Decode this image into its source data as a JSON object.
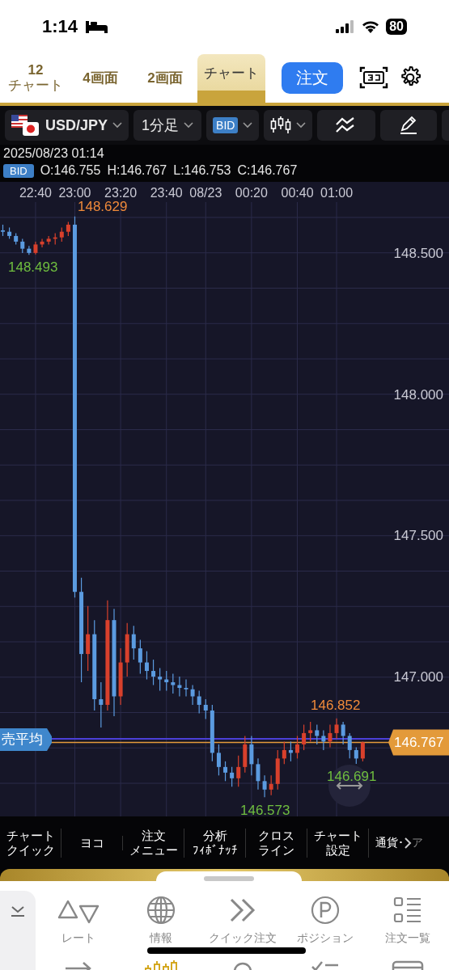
{
  "status_bar": {
    "time": "1:14",
    "battery": "80"
  },
  "tabs": [
    {
      "lines": [
        "12",
        "チャート"
      ],
      "selected": false
    },
    {
      "lines": [
        "4画面"
      ],
      "selected": false
    },
    {
      "lines": [
        "2画面"
      ],
      "selected": false
    },
    {
      "lines": [
        "チャート"
      ],
      "selected": true
    }
  ],
  "order_button": "注文",
  "toolbar": {
    "pair": "USD/JPY",
    "timeframe": "1分足",
    "price_type": "BID"
  },
  "info": {
    "datetime": "2025/08/23 01:14",
    "price_type": "BID",
    "ohlc": [
      "O:146.755",
      "H:146.767",
      "L:146.753",
      "C:146.767"
    ]
  },
  "chart": {
    "chart_data": {
      "type": "candlestick",
      "grid": true,
      "ylim": [
        146.505,
        148.68
      ],
      "categories": [
        null,
        null,
        null,
        null,
        null,
        "22:40",
        null,
        null,
        null,
        null,
        null,
        "23:00",
        null,
        null,
        null,
        null,
        null,
        null,
        "23:20",
        null,
        null,
        null,
        null,
        null,
        null,
        "23:40",
        null,
        null,
        null,
        null,
        null,
        "08/23",
        null,
        null,
        null,
        null,
        null,
        null,
        "00:20",
        null,
        null,
        null,
        null,
        null,
        null,
        "00:40",
        null,
        null,
        null,
        null,
        null,
        "01:00",
        null,
        null,
        null,
        null
      ],
      "ref_lines": [
        {
          "axis": "y",
          "label": "売平均",
          "value": 146.78,
          "color": "#4b3fd8"
        },
        {
          "axis": "y",
          "label": "146.767",
          "value": 146.767,
          "color": "#e39a3a"
        }
      ],
      "yticks": [
        {
          "value": 148.5,
          "label": "148.500"
        },
        {
          "value": 148.0,
          "label": "148.000"
        },
        {
          "value": 147.5,
          "label": "147.500"
        },
        {
          "value": 147.0,
          "label": "147.000"
        }
      ],
      "ohlc": [
        [
          148.58,
          148.6,
          148.56,
          148.575
        ],
        [
          148.575,
          148.59,
          148.55,
          148.56
        ],
        [
          148.56,
          148.57,
          148.53,
          148.54
        ],
        [
          148.54,
          148.55,
          148.5,
          148.515
        ],
        [
          148.515,
          148.525,
          148.493,
          148.5
        ],
        [
          148.5,
          148.54,
          148.495,
          148.53
        ],
        [
          148.53,
          148.55,
          148.52,
          148.54
        ],
        [
          148.54,
          148.56,
          148.53,
          148.55
        ],
        [
          148.55,
          148.57,
          148.53,
          148.555
        ],
        [
          148.555,
          148.59,
          148.54,
          148.575
        ],
        [
          148.575,
          148.61,
          148.56,
          148.6
        ],
        [
          148.6,
          148.629,
          147.28,
          147.3
        ],
        [
          147.3,
          147.35,
          146.98,
          147.08
        ],
        [
          147.08,
          147.25,
          147.02,
          147.15
        ],
        [
          147.15,
          147.2,
          146.88,
          146.92
        ],
        [
          146.92,
          146.98,
          146.82,
          146.9
        ],
        [
          146.9,
          147.27,
          146.88,
          147.2
        ],
        [
          147.2,
          147.24,
          146.86,
          146.93
        ],
        [
          146.93,
          147.1,
          146.9,
          147.05
        ],
        [
          147.05,
          147.19,
          147.0,
          147.15
        ],
        [
          147.15,
          147.18,
          147.06,
          147.1
        ],
        [
          147.1,
          147.13,
          147.01,
          147.05
        ],
        [
          147.05,
          147.09,
          146.99,
          147.02
        ],
        [
          147.02,
          147.06,
          146.97,
          147.0
        ],
        [
          147.0,
          147.03,
          146.95,
          146.99
        ],
        [
          146.99,
          147.02,
          146.95,
          146.98
        ],
        [
          146.98,
          147.01,
          146.94,
          146.97
        ],
        [
          146.97,
          147.0,
          146.93,
          146.96
        ],
        [
          146.96,
          146.99,
          146.93,
          146.955
        ],
        [
          146.955,
          146.97,
          146.9,
          146.93
        ],
        [
          146.93,
          146.95,
          146.87,
          146.9
        ],
        [
          146.9,
          146.92,
          146.85,
          146.88
        ],
        [
          146.88,
          146.9,
          146.7,
          146.73
        ],
        [
          146.73,
          146.76,
          146.65,
          146.68
        ],
        [
          146.68,
          146.7,
          146.63,
          146.66
        ],
        [
          146.66,
          146.68,
          146.61,
          146.64
        ],
        [
          146.64,
          146.72,
          146.61,
          146.68
        ],
        [
          146.68,
          146.79,
          146.66,
          146.76
        ],
        [
          146.76,
          146.79,
          146.65,
          146.69
        ],
        [
          146.69,
          146.71,
          146.6,
          146.63
        ],
        [
          146.63,
          146.65,
          146.573,
          146.6
        ],
        [
          146.6,
          146.65,
          146.58,
          146.62
        ],
        [
          146.62,
          146.74,
          146.6,
          146.71
        ],
        [
          146.71,
          146.77,
          146.69,
          146.74
        ],
        [
          146.74,
          146.77,
          146.7,
          146.73
        ],
        [
          146.73,
          146.79,
          146.71,
          146.76
        ],
        [
          146.76,
          146.83,
          146.74,
          146.8
        ],
        [
          146.8,
          146.84,
          146.77,
          146.81
        ],
        [
          146.81,
          146.83,
          146.76,
          146.79
        ],
        [
          146.79,
          146.81,
          146.74,
          146.77
        ],
        [
          146.77,
          146.83,
          146.75,
          146.8
        ],
        [
          146.8,
          146.852,
          146.78,
          146.83
        ],
        [
          146.83,
          146.84,
          146.76,
          146.79
        ],
        [
          146.79,
          146.8,
          146.71,
          146.74
        ],
        [
          146.74,
          146.75,
          146.691,
          146.71
        ],
        [
          146.71,
          146.77,
          146.7,
          146.767
        ]
      ]
    },
    "annotations": [
      {
        "kind": "high",
        "text": "148.629"
      },
      {
        "kind": "low",
        "text": "148.493"
      },
      {
        "kind": "high",
        "text": "146.852"
      },
      {
        "kind": "low",
        "text": "146.691"
      },
      {
        "kind": "low",
        "text": "146.573"
      }
    ]
  },
  "bottom_menu": [
    {
      "lines": [
        "チャート",
        "クイック"
      ]
    },
    {
      "lines": [
        "ヨコ"
      ]
    },
    {
      "lines": [
        "注文",
        "メニュー"
      ]
    },
    {
      "lines": [
        "分析",
        "ﾌｨﾎﾞﾅｯﾁ"
      ]
    },
    {
      "lines": [
        "クロス",
        "ライン"
      ]
    },
    {
      "lines": [
        "チャート",
        "設定"
      ]
    }
  ],
  "bottom_menu_more": [
    "通貨･",
    "ア"
  ],
  "nav": [
    "レート",
    "情報",
    "クイック注文",
    "ポジション",
    "注文一覧"
  ]
}
